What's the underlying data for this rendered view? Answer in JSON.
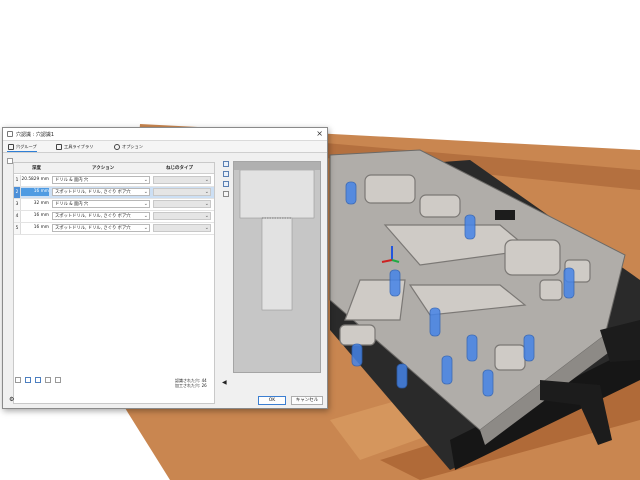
{
  "dialog": {
    "title": "穴認識 : 穴認識1",
    "close_glyph": "×",
    "tabs": [
      "穴グループ",
      "工具ライブラリ",
      "オプション"
    ],
    "columns": {
      "depth": "深度",
      "action": "アクション",
      "thread": "ねじのタイプ"
    },
    "rows": [
      {
        "index": "1",
        "depth": "20.5829 mm",
        "action": "ドリル & 面内 穴"
      },
      {
        "index": "2",
        "depth": "16 mm",
        "action": "スポットドリル, ドリル, さぐり ボア穴"
      },
      {
        "index": "3",
        "depth": "32 mm",
        "action": "ドリル & 面内 穴"
      },
      {
        "index": "4",
        "depth": "16 mm",
        "action": "スポットドリル, ドリル, さぐり ボア穴"
      },
      {
        "index": "5",
        "depth": "16 mm",
        "action": "スポットドリル, ドリル, さぐり ボア穴"
      }
    ],
    "selected_row": 2,
    "counts": {
      "recognized": "認識された穴: 44",
      "processed": "加工された穴: 26"
    },
    "ok_label": "OK",
    "cancel_label": "キャンセル"
  },
  "colors": {
    "selection": "#ccdff4",
    "accent": "#3b7ed1",
    "part": "#a9a6a2",
    "table": "#c67a3f",
    "tool_blue": "#3f7fe0"
  }
}
